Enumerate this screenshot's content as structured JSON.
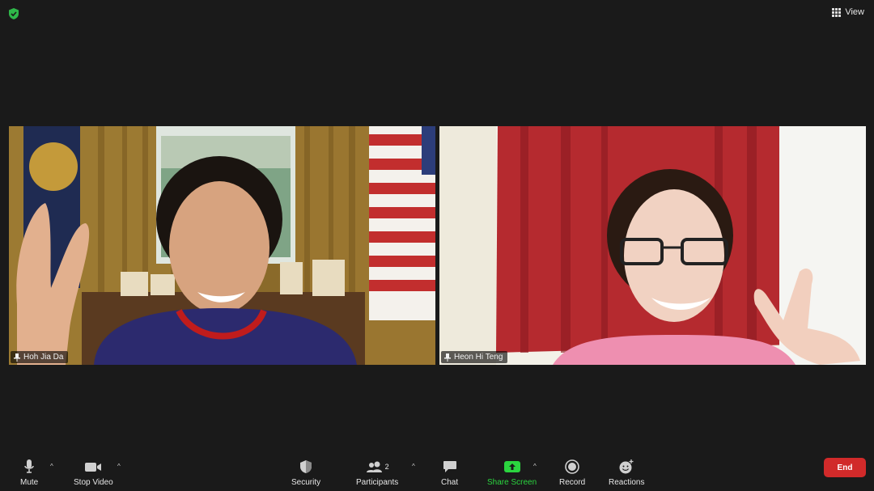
{
  "top": {
    "view_label": "View"
  },
  "participants_tiles": [
    {
      "name": "Hoh Jia Da"
    },
    {
      "name": "Heon Hi Teng"
    }
  ],
  "toolbar": {
    "mute_label": "Mute",
    "stop_video_label": "Stop Video",
    "security_label": "Security",
    "participants_label": "Participants",
    "participants_count": "2",
    "chat_label": "Chat",
    "share_screen_label": "Share Screen",
    "record_label": "Record",
    "reactions_label": "Reactions",
    "end_label": "End"
  },
  "colors": {
    "background": "#1a1a1a",
    "share_green": "#2bd43f",
    "end_red": "#d12a2a",
    "shield_green": "#2fb84a"
  }
}
